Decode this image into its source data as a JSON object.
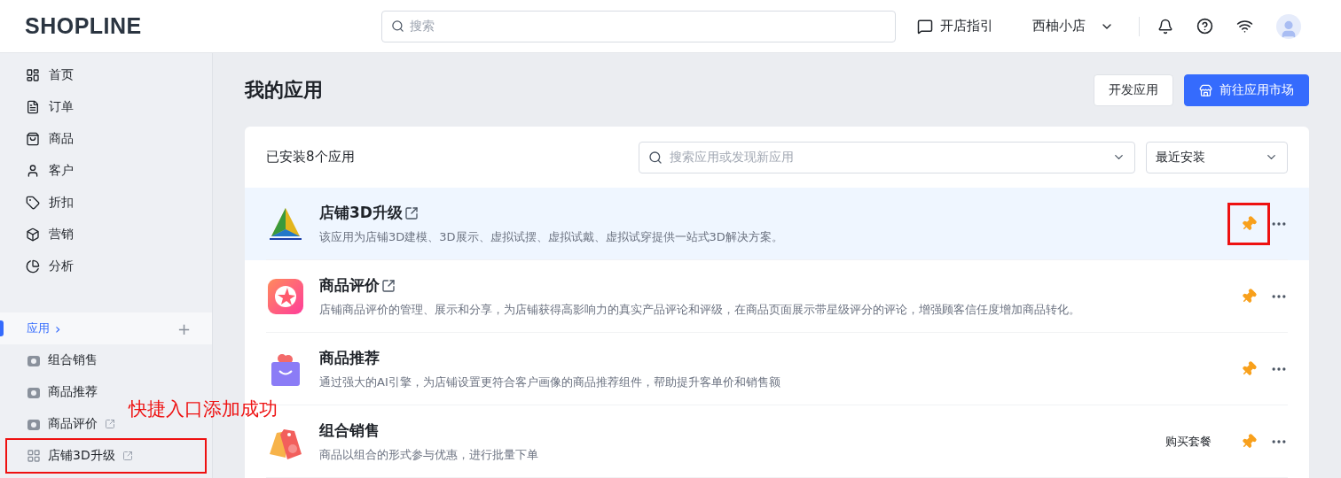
{
  "header": {
    "logo": "SHOPLINE",
    "search": {
      "placeholder": "搜索"
    },
    "guide": "开店指引",
    "store": "西柚小店"
  },
  "sidebar": {
    "items": [
      {
        "label": "首页",
        "selected": false
      },
      {
        "label": "订单",
        "selected": false
      },
      {
        "label": "商品",
        "selected": false
      },
      {
        "label": "客户",
        "selected": false
      },
      {
        "label": "折扣",
        "selected": false
      },
      {
        "label": "营销",
        "selected": false
      },
      {
        "label": "分析",
        "selected": false
      }
    ],
    "apps_section": {
      "label": "应用",
      "selected": true,
      "chevron": "›",
      "add": "+"
    },
    "apps": [
      {
        "label": "组合销售",
        "external": false,
        "outlined": false
      },
      {
        "label": "商品推荐",
        "external": false,
        "outlined": false
      },
      {
        "label": "商品评价",
        "external": true,
        "outlined": false
      },
      {
        "label": "店铺3D升级",
        "external": true,
        "outlined": true
      }
    ]
  },
  "annotation": "快捷入口添加成功",
  "page": {
    "title": "我的应用",
    "buttons": [
      {
        "label": "开发应用",
        "kind": "secondary"
      },
      {
        "label": "前往应用市场",
        "kind": "primary"
      }
    ]
  },
  "card": {
    "count": "已安装8个应用",
    "search": {
      "placeholder": "搜索应用或发现新应用"
    },
    "sort": "最近安装",
    "rows": [
      {
        "name": "店铺3D升级",
        "description": "该应用为店铺3D建模、3D展示、虚拟试摆、虚拟试戴、虚拟试穿提供一站式3D解决方案。",
        "external": true,
        "highlighted": true,
        "pinned": true,
        "pin_outlined": true
      },
      {
        "name": "商品评价",
        "description": "店铺商品评价的管理、展示和分享，为店铺获得高影响力的真实产品评论和评级，在商品页面展示带星级评分的评论，增强顾客信任度增加商品转化。",
        "external": true,
        "highlighted": false,
        "pinned": true,
        "pin_outlined": false
      },
      {
        "name": "商品推荐",
        "description": "通过强大的AI引擎，为店铺设置更符合客户画像的商品推荐组件，帮助提升客单价和销售额",
        "external": false,
        "highlighted": false,
        "pinned": true,
        "pin_outlined": false
      },
      {
        "name": "组合销售",
        "description": "商品以组合的形式参与优惠，进行批量下单",
        "external": false,
        "highlighted": false,
        "pinned": true,
        "pin_outlined": false,
        "action": "购买套餐"
      }
    ]
  }
}
